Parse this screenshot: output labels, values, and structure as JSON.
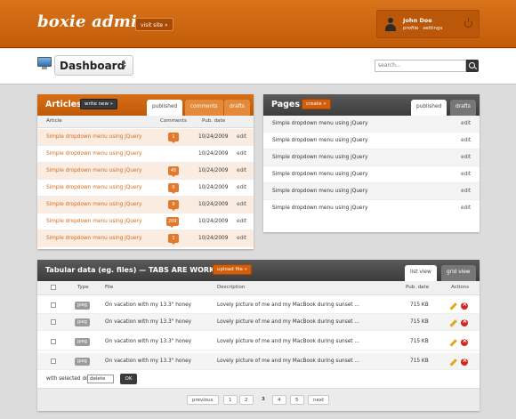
{
  "header": {
    "logo": "boxie admin",
    "visit_site": "visit site »"
  },
  "user": {
    "name": "John Doe",
    "profile": "profile",
    "settings": "settings"
  },
  "subheader": {
    "title": "Dashboard",
    "search_placeholder": "search..."
  },
  "articles": {
    "title": "Articles",
    "write_new": "write new »",
    "tabs": [
      "published",
      "comments",
      "drafts"
    ],
    "columns": {
      "article": "Article",
      "comments": "Comments",
      "pub_date": "Pub. date"
    },
    "rows": [
      {
        "title": "Simple dropdown menu using jQuery",
        "comments": "1",
        "date": "10/24/2009",
        "action": "edit"
      },
      {
        "title": "Simple dropdown menu using jQuery",
        "comments": "",
        "date": "10/24/2009",
        "action": "edit"
      },
      {
        "title": "Simple dropdown menu using jQuery",
        "comments": "45",
        "date": "10/24/2009",
        "action": "edit"
      },
      {
        "title": "Simple dropdown menu using jQuery",
        "comments": "0",
        "date": "10/24/2009",
        "action": "edit"
      },
      {
        "title": "Simple dropdown menu using jQuery",
        "comments": "9",
        "date": "10/24/2009",
        "action": "edit"
      },
      {
        "title": "Simple dropdown menu using jQuery",
        "comments": "209",
        "date": "10/24/2009",
        "action": "edit"
      },
      {
        "title": "Simple dropdown menu using jQuery",
        "comments": "1",
        "date": "10/24/2009",
        "action": "edit"
      }
    ]
  },
  "pages": {
    "title": "Pages",
    "create": "create »",
    "tabs": [
      "published",
      "drafts"
    ],
    "rows": [
      {
        "title": "Simple dropdown menu using jQuery",
        "action": "edit"
      },
      {
        "title": "Simple dropdown menu using jQuery",
        "action": "edit"
      },
      {
        "title": "Simple dropdown menu using jQuery",
        "action": "edit"
      },
      {
        "title": "Simple dropdown menu using jQuery",
        "action": "edit"
      },
      {
        "title": "Simple dropdown menu using jQuery",
        "action": "edit"
      },
      {
        "title": "Simple dropdown menu using jQuery",
        "action": "edit"
      }
    ]
  },
  "files": {
    "title": "Tabular data (eg. files) — TABS ARE WORKING",
    "upload": "upload file »",
    "tabs": [
      "list view",
      "grid view"
    ],
    "columns": {
      "type": "Type",
      "file": "File",
      "description": "Description",
      "pub_date": "Pub. date",
      "actions": "Actions"
    },
    "rows": [
      {
        "type": "jpeg",
        "file": "On vacation with my 13.3\" honey",
        "description": "Lovely picture of me and my MacBook during sunset ...",
        "size": "715 KB"
      },
      {
        "type": "jpeg",
        "file": "On vacation with my 13.3\" honey",
        "description": "Lovely picture of me and my MacBook during sunset ...",
        "size": "715 KB"
      },
      {
        "type": "jpeg",
        "file": "On vacation with my 13.3\" honey",
        "description": "Lovely picture of me and my MacBook during sunset ...",
        "size": "715 KB"
      },
      {
        "type": "jpeg",
        "file": "On vacation with my 13.3\" honey",
        "description": "Lovely picture of me and my MacBook during sunset ...",
        "size": "715 KB"
      }
    ],
    "with_selected": "with selected do:",
    "select_value": "delete",
    "ok": "OK"
  },
  "pagination": {
    "previous": "previous",
    "pages": [
      "1",
      "2",
      "3",
      "4",
      "5"
    ],
    "current": "3",
    "next": "next"
  },
  "colors": {
    "accent": "#c96209",
    "dark_header": "#444444"
  }
}
